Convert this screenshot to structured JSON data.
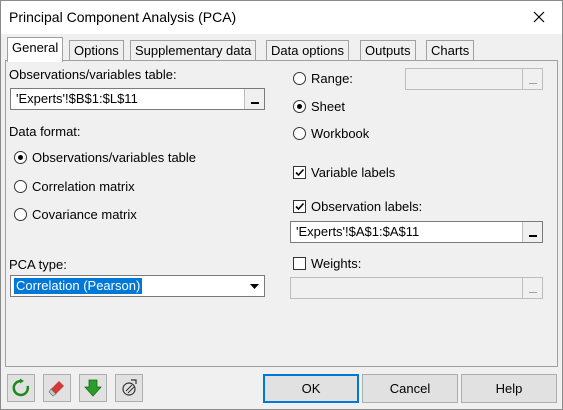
{
  "window": {
    "title": "Principal Component Analysis (PCA)",
    "close_glyph": "✕"
  },
  "tabs": [
    {
      "label": "General",
      "active": true
    },
    {
      "label": "Options"
    },
    {
      "label": "Supplementary data"
    },
    {
      "label": "Data options"
    },
    {
      "label": "Outputs"
    },
    {
      "label": "Charts"
    }
  ],
  "left": {
    "table_label": "Observations/variables table:",
    "table_value": "'Experts'!$B$1:$L$11",
    "format_label": "Data format:",
    "format_options": [
      {
        "label": "Observations/variables table",
        "selected": true
      },
      {
        "label": "Correlation matrix",
        "selected": false
      },
      {
        "label": "Covariance matrix",
        "selected": false
      }
    ],
    "pca_type_label": "PCA type:",
    "pca_type_value": "Correlation (Pearson)"
  },
  "right": {
    "range_options": [
      {
        "label": "Range:",
        "selected": false
      },
      {
        "label": "Sheet",
        "selected": true
      },
      {
        "label": "Workbook",
        "selected": false
      }
    ],
    "range_value": "",
    "variable_labels": {
      "label": "Variable labels",
      "checked": true
    },
    "observation_labels": {
      "label": "Observation labels:",
      "checked": true,
      "value": "'Experts'!$A$1:$A$11"
    },
    "weights": {
      "label": "Weights:",
      "checked": false,
      "value": ""
    }
  },
  "footer": {
    "icons": [
      "reset-icon",
      "eraser-icon",
      "down-arrow-icon",
      "hide-options-icon"
    ],
    "ok_label": "OK",
    "cancel_label": "Cancel",
    "help_label": "Help"
  },
  "colors": {
    "selection": "#0078d7",
    "reset_green": "#1e8a1e",
    "arrow_green": "#2a9d2a",
    "eraser_red": "#d03a3a"
  }
}
